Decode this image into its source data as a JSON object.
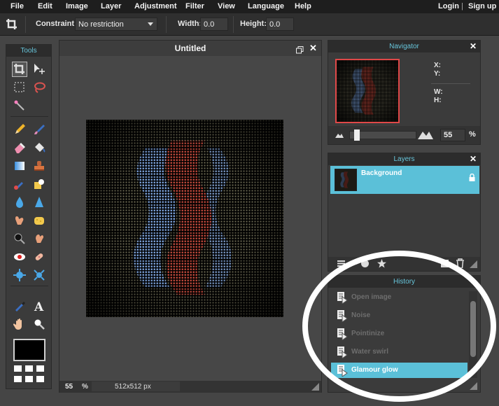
{
  "menu": [
    "File",
    "Edit",
    "Image",
    "Layer",
    "Adjustment",
    "Filter",
    "View",
    "Language",
    "Help"
  ],
  "account": {
    "login": "Login",
    "separator": "|",
    "signup": "Sign up"
  },
  "options": {
    "constraint_label": "Constraint:",
    "constraint_value": "No restriction",
    "width_label": "Width:",
    "width_value": "0.0",
    "height_label": "Height:",
    "height_value": "0.0"
  },
  "tools": {
    "title": "Tools",
    "close": "",
    "items": [
      "crop",
      "move",
      "marquee",
      "lasso",
      "magic-wand",
      "pencil",
      "brush",
      "eraser",
      "bucket",
      "gradient",
      "clone-stamp",
      "color-replace",
      "drawing",
      "blur",
      "sharpen",
      "smudge",
      "sponge",
      "dodge",
      "burn",
      "red-eye",
      "spot-heal",
      "bloat",
      "pinch",
      "color-picker",
      "type",
      "hand",
      "zoom"
    ],
    "active": "crop",
    "primary_color": "#000000"
  },
  "document": {
    "title": "Untitled",
    "zoom": "55",
    "zoom_unit": "%",
    "size": "512x512 px"
  },
  "navigator": {
    "title": "Navigator",
    "x_label": "X:",
    "y_label": "Y:",
    "w_label": "W:",
    "h_label": "H:",
    "zoom": "55",
    "zoom_unit": "%",
    "slider_level": 0.08
  },
  "layers": {
    "title": "Layers",
    "items": [
      {
        "name": "Background",
        "locked": true,
        "selected": true
      }
    ]
  },
  "history": {
    "title": "History",
    "items": [
      "Open image",
      "Noise",
      "Pointinize",
      "Water swirl",
      "Glamour glow"
    ],
    "active_index": 4
  },
  "colors": {
    "accent": "#5bc0d8",
    "panel_title_text": "#67c5db",
    "highlight_circle": "#ffffff"
  }
}
